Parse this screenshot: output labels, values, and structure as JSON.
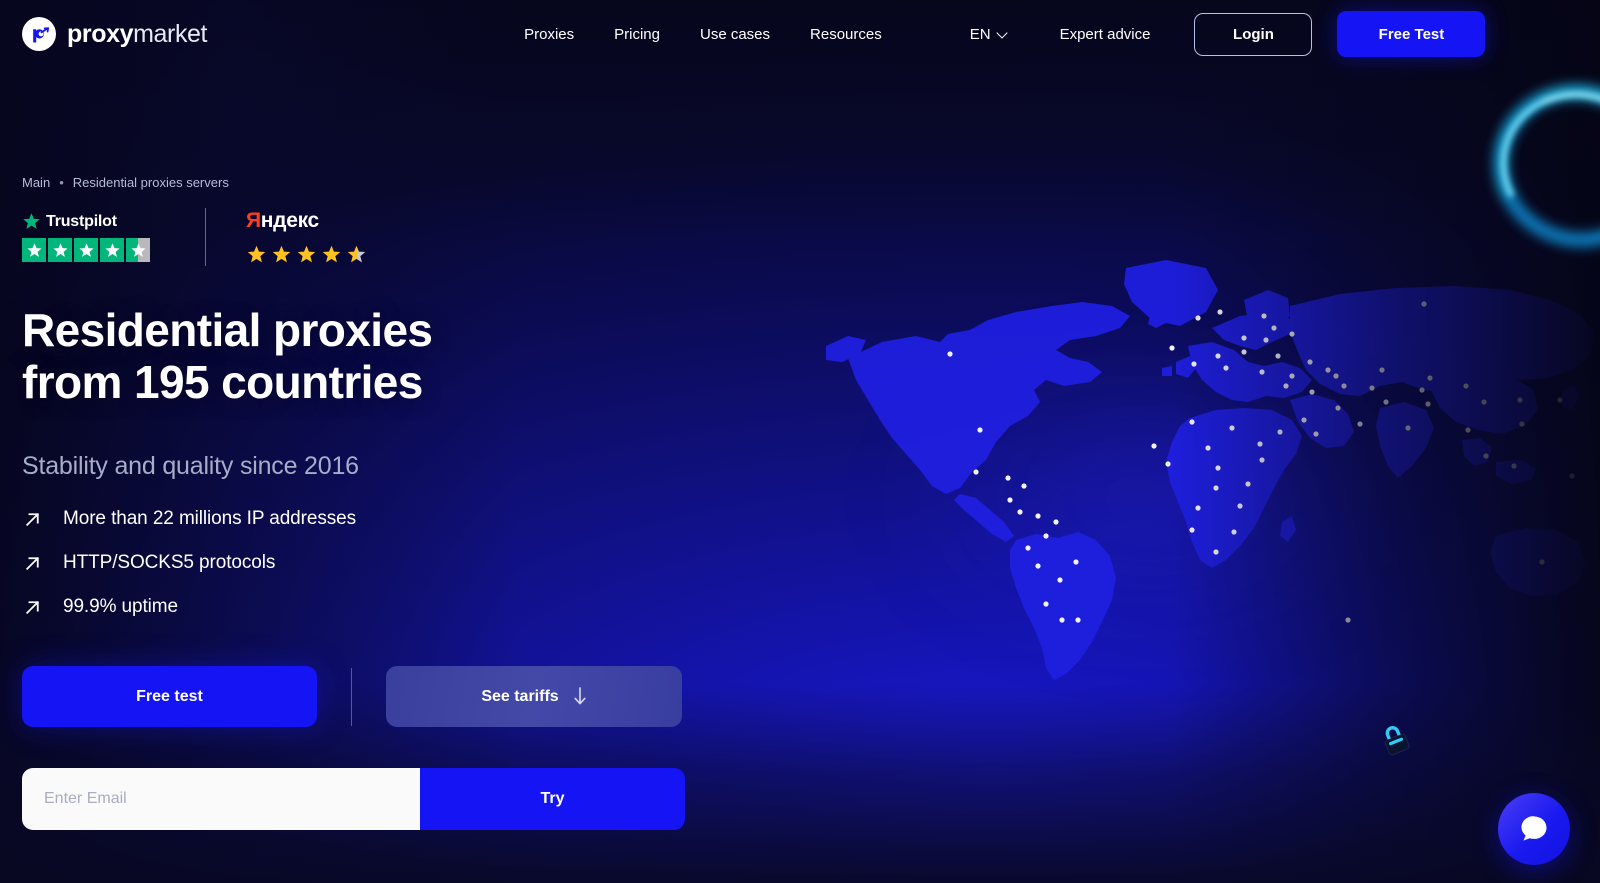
{
  "brand": {
    "name_bold": "proxy",
    "name_light": "market",
    "logo_icon": "proxymarket-logo-icon",
    "accent": "#1414f5",
    "bg_deep": "#0a0a32"
  },
  "header": {
    "nav": [
      {
        "label": "Proxies"
      },
      {
        "label": "Pricing"
      },
      {
        "label": "Use cases"
      },
      {
        "label": "Resources"
      }
    ],
    "language": {
      "label": "EN",
      "icon": "chevron-down-icon"
    },
    "expert_advice": "Expert advice",
    "login": "Login",
    "free_test": "Free Test"
  },
  "breadcrumb": {
    "home": "Main",
    "separator": "•",
    "current": "Residential proxies servers"
  },
  "ratings": [
    {
      "platform": "Trustpilot",
      "logo_icon": "trustpilot-star-icon",
      "stars_total": 5,
      "stars_filled": 4.5,
      "star_color": "#00b67a"
    },
    {
      "platform_prefix": "Я",
      "platform_suffix": "ндекс",
      "stars_total": 5,
      "stars_filled": 4.5,
      "star_color": "#ffc221"
    }
  ],
  "hero": {
    "title_line1": "Residential proxies",
    "title_line2": "from 195 countries",
    "subtitle": "Stability and quality since 2016",
    "features": [
      {
        "icon": "arrow-up-right-icon",
        "label": "More than 22 millions IP addresses"
      },
      {
        "icon": "arrow-up-right-icon",
        "label": "HTTP/SOCKS5 protocols"
      },
      {
        "icon": "arrow-up-right-icon",
        "label": "99.9% uptime"
      }
    ],
    "cta_primary": "Free test",
    "cta_secondary": "See tariffs",
    "cta_secondary_icon": "arrow-down-icon",
    "email_placeholder": "Enter Email",
    "email_value": "",
    "email_submit": "Try"
  },
  "widgets": {
    "chat_icon": "chat-bubble-icon",
    "lock_icon": "padlock-icon"
  },
  "map": {
    "alt": "world-map-with-proxy-locations",
    "land_color": "#1f1fe0",
    "ocean_color": "#0a0a2e",
    "dot_color": "#ffffff"
  }
}
